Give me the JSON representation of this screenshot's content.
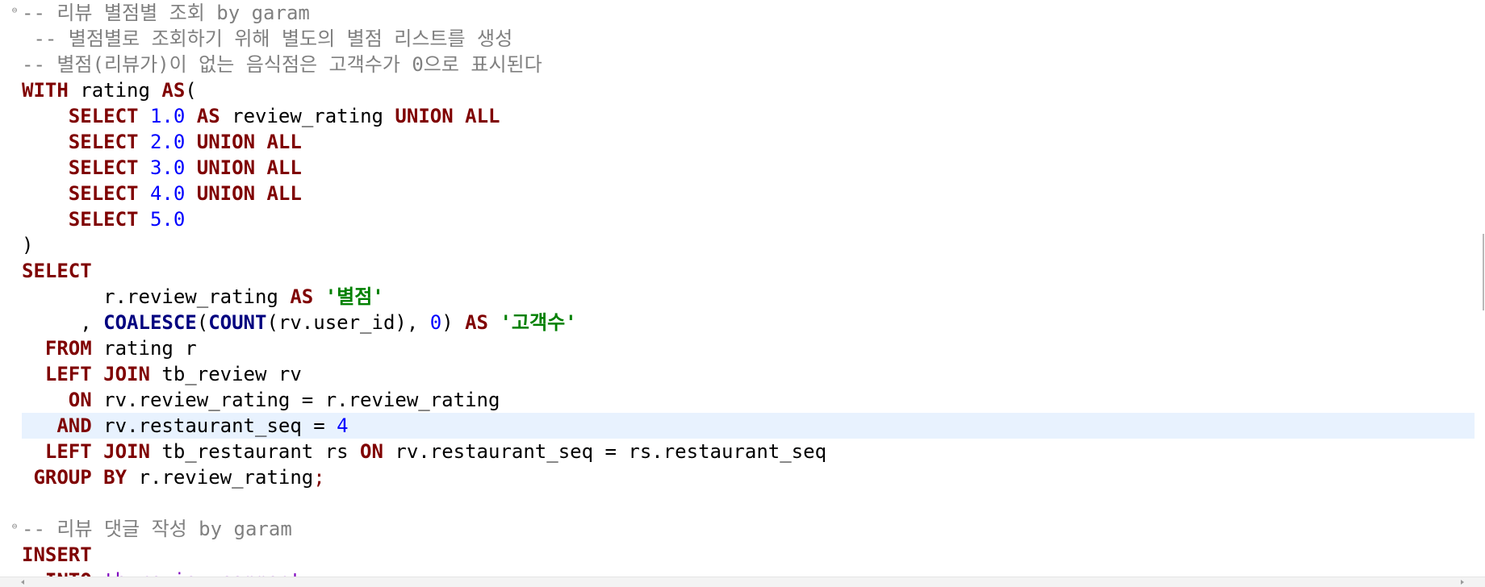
{
  "editor": {
    "fold_glyph": "⊖",
    "lines": [
      {
        "fold": true,
        "current": false,
        "tokens": [
          {
            "t": "cm",
            "v": "-- 리뷰 별점별 조회 by garam"
          }
        ]
      },
      {
        "fold": false,
        "current": false,
        "tokens": [
          {
            "t": "cm",
            "v": " -- 별점별로 조회하기 위해 별도의 별점 리스트를 생성"
          }
        ]
      },
      {
        "fold": false,
        "current": false,
        "tokens": [
          {
            "t": "cm",
            "v": "-- 별점(리뷰가)이 없는 음식점은 고객수가 0으로 표시된다"
          }
        ]
      },
      {
        "fold": false,
        "current": false,
        "tokens": [
          {
            "t": "kw",
            "v": "WITH"
          },
          {
            "t": "plain",
            "v": " rating "
          },
          {
            "t": "kw",
            "v": "AS"
          },
          {
            "t": "plain",
            "v": "("
          }
        ]
      },
      {
        "fold": false,
        "current": false,
        "tokens": [
          {
            "t": "plain",
            "v": "    "
          },
          {
            "t": "kw",
            "v": "SELECT"
          },
          {
            "t": "plain",
            "v": " "
          },
          {
            "t": "num",
            "v": "1.0"
          },
          {
            "t": "plain",
            "v": " "
          },
          {
            "t": "kw",
            "v": "AS"
          },
          {
            "t": "plain",
            "v": " review_rating "
          },
          {
            "t": "kw",
            "v": "UNION ALL"
          }
        ]
      },
      {
        "fold": false,
        "current": false,
        "tokens": [
          {
            "t": "plain",
            "v": "    "
          },
          {
            "t": "kw",
            "v": "SELECT"
          },
          {
            "t": "plain",
            "v": " "
          },
          {
            "t": "num",
            "v": "2.0"
          },
          {
            "t": "plain",
            "v": " "
          },
          {
            "t": "kw",
            "v": "UNION ALL"
          }
        ]
      },
      {
        "fold": false,
        "current": false,
        "tokens": [
          {
            "t": "plain",
            "v": "    "
          },
          {
            "t": "kw",
            "v": "SELECT"
          },
          {
            "t": "plain",
            "v": " "
          },
          {
            "t": "num",
            "v": "3.0"
          },
          {
            "t": "plain",
            "v": " "
          },
          {
            "t": "kw",
            "v": "UNION ALL"
          }
        ]
      },
      {
        "fold": false,
        "current": false,
        "tokens": [
          {
            "t": "plain",
            "v": "    "
          },
          {
            "t": "kw",
            "v": "SELECT"
          },
          {
            "t": "plain",
            "v": " "
          },
          {
            "t": "num",
            "v": "4.0"
          },
          {
            "t": "plain",
            "v": " "
          },
          {
            "t": "kw",
            "v": "UNION ALL"
          }
        ]
      },
      {
        "fold": false,
        "current": false,
        "tokens": [
          {
            "t": "plain",
            "v": "    "
          },
          {
            "t": "kw",
            "v": "SELECT"
          },
          {
            "t": "plain",
            "v": " "
          },
          {
            "t": "num",
            "v": "5.0"
          }
        ]
      },
      {
        "fold": false,
        "current": false,
        "tokens": [
          {
            "t": "plain",
            "v": ")"
          }
        ]
      },
      {
        "fold": false,
        "current": false,
        "tokens": [
          {
            "t": "kw",
            "v": "SELECT"
          }
        ]
      },
      {
        "fold": false,
        "current": false,
        "tokens": [
          {
            "t": "plain",
            "v": "       r.review_rating "
          },
          {
            "t": "kw",
            "v": "AS"
          },
          {
            "t": "plain",
            "v": " "
          },
          {
            "t": "str",
            "v": "'별점'"
          }
        ]
      },
      {
        "fold": false,
        "current": false,
        "tokens": [
          {
            "t": "plain",
            "v": "     , "
          },
          {
            "t": "fn",
            "v": "COALESCE"
          },
          {
            "t": "plain",
            "v": "("
          },
          {
            "t": "fn",
            "v": "COUNT"
          },
          {
            "t": "plain",
            "v": "(rv.user_id), "
          },
          {
            "t": "num",
            "v": "0"
          },
          {
            "t": "plain",
            "v": ") "
          },
          {
            "t": "kw",
            "v": "AS"
          },
          {
            "t": "plain",
            "v": " "
          },
          {
            "t": "str",
            "v": "'고객수'"
          }
        ]
      },
      {
        "fold": false,
        "current": false,
        "tokens": [
          {
            "t": "plain",
            "v": "  "
          },
          {
            "t": "kw",
            "v": "FROM"
          },
          {
            "t": "plain",
            "v": " rating r"
          }
        ]
      },
      {
        "fold": false,
        "current": false,
        "tokens": [
          {
            "t": "plain",
            "v": "  "
          },
          {
            "t": "kw",
            "v": "LEFT JOIN"
          },
          {
            "t": "plain",
            "v": " tb_review rv"
          }
        ]
      },
      {
        "fold": false,
        "current": false,
        "tokens": [
          {
            "t": "plain",
            "v": "    "
          },
          {
            "t": "kw",
            "v": "ON"
          },
          {
            "t": "plain",
            "v": " rv.review_rating = r.review_rating"
          }
        ]
      },
      {
        "fold": false,
        "current": true,
        "tokens": [
          {
            "t": "plain",
            "v": "   "
          },
          {
            "t": "kw",
            "v": "AND"
          },
          {
            "t": "plain",
            "v": " rv.restaurant_seq = "
          },
          {
            "t": "num",
            "v": "4"
          }
        ]
      },
      {
        "fold": false,
        "current": false,
        "tokens": [
          {
            "t": "plain",
            "v": "  "
          },
          {
            "t": "kw",
            "v": "LEFT JOIN"
          },
          {
            "t": "plain",
            "v": " tb_restaurant rs "
          },
          {
            "t": "kw",
            "v": "ON"
          },
          {
            "t": "plain",
            "v": " rv.restaurant_seq = rs.restaurant_seq"
          }
        ]
      },
      {
        "fold": false,
        "current": false,
        "tokens": [
          {
            "t": "plain",
            "v": " "
          },
          {
            "t": "kw",
            "v": "GROUP BY"
          },
          {
            "t": "plain",
            "v": " r.review_rating"
          },
          {
            "t": "op",
            "v": ";"
          }
        ]
      },
      {
        "fold": false,
        "current": false,
        "tokens": [
          {
            "t": "plain",
            "v": ""
          }
        ]
      },
      {
        "fold": true,
        "current": false,
        "tokens": [
          {
            "t": "cm",
            "v": "-- 리뷰 댓글 작성 by garam"
          }
        ]
      },
      {
        "fold": false,
        "current": false,
        "tokens": [
          {
            "t": "kw",
            "v": "INSERT"
          }
        ]
      },
      {
        "fold": false,
        "current": false,
        "tokens": [
          {
            "t": "plain",
            "v": "  "
          },
          {
            "t": "kw",
            "v": "INTO"
          },
          {
            "t": "plain",
            "v": " "
          },
          {
            "t": "tbl",
            "v": "tb_review_comment"
          }
        ]
      }
    ]
  }
}
